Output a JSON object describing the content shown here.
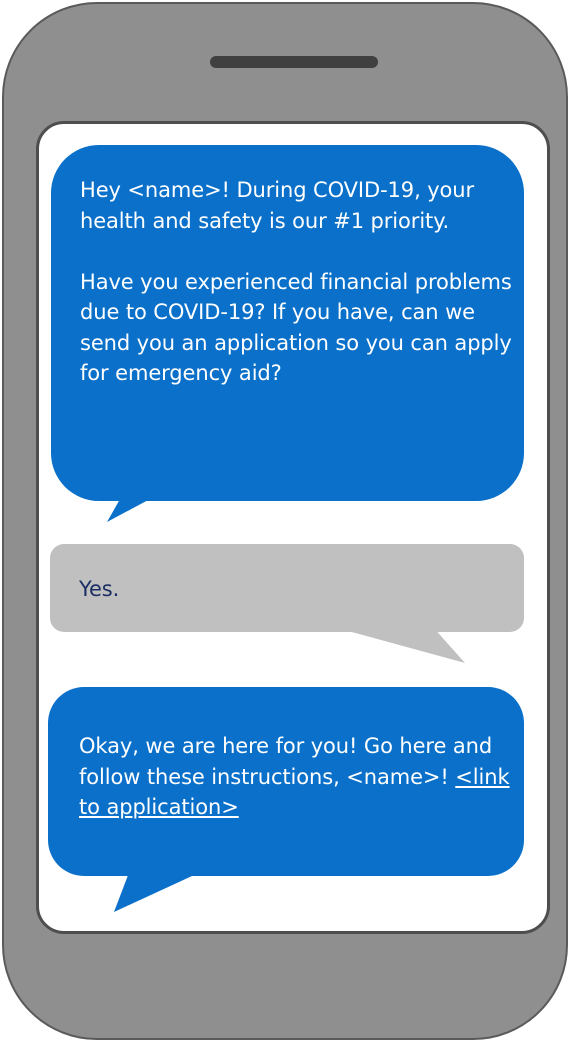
{
  "colors": {
    "phone_body": "#8f8f8f",
    "phone_border": "#5a5a5a",
    "incoming_bubble": "#0a70c9",
    "outgoing_bubble": "#c0c0c0",
    "outgoing_text": "#1b2e64",
    "screen": "#ffffff"
  },
  "messages": [
    {
      "sender": "organization",
      "text": "Hey <name>! During COVID-19, your health and safety is our #1 priority.\n\nHave you experienced financial problems due to COVID-19? If you have, can we send you an application so you can apply for emergency aid?"
    },
    {
      "sender": "user",
      "text": "Yes."
    },
    {
      "sender": "organization",
      "text": "Okay, we are here for you! Go here and follow these instructions, <name>! ",
      "link_text": "<link to application>"
    }
  ]
}
